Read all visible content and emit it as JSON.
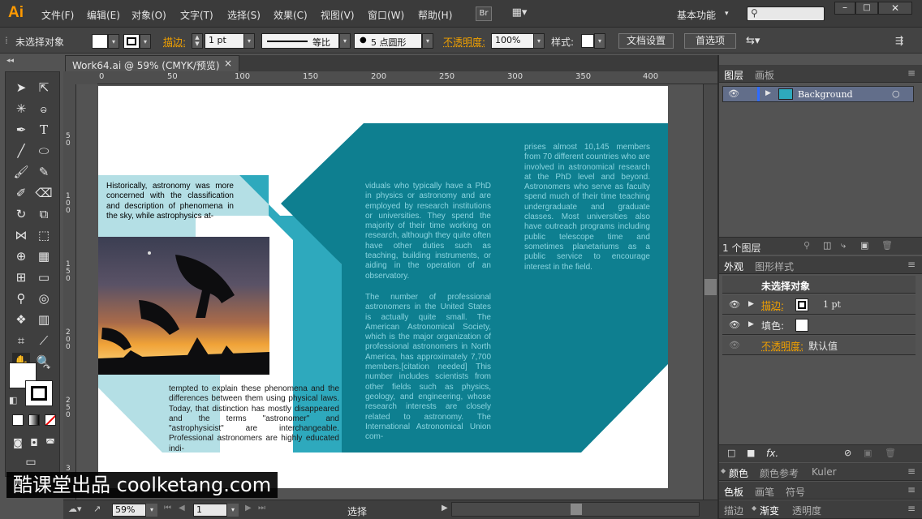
{
  "app": {
    "logo": "Ai"
  },
  "menu": [
    "文件(F)",
    "编辑(E)",
    "对象(O)",
    "文字(T)",
    "选择(S)",
    "效果(C)",
    "视图(V)",
    "窗口(W)",
    "帮助(H)"
  ],
  "menubar_right": {
    "br": "Br",
    "workspace": "基本功能"
  },
  "controlbar": {
    "selection": "未选择对象",
    "stroke_label": "描边:",
    "stroke_weight": "1 pt",
    "profile": "等比",
    "brush": "5 点圆形",
    "opacity_label": "不透明度:",
    "opacity_value": "100%",
    "style_label": "样式:",
    "doc_setup": "文档设置",
    "preferences": "首选项"
  },
  "document_tab": {
    "title": "Work64.ai @ 59% (CMYK/预览)",
    "close": "×"
  },
  "ruler_top_ticks": [
    "0",
    "50",
    "100",
    "150",
    "200",
    "250",
    "300",
    "350",
    "400"
  ],
  "ruler_left_ticks": [
    "5\n0",
    "1\n0\n0",
    "1\n5\n0",
    "2\n0\n0",
    "2\n5\n0",
    "3"
  ],
  "artwork": {
    "colors": {
      "teal": "#0e7f90",
      "teal_light": "#2ea9bd",
      "pale": "#b4dfe5",
      "text_on_teal": "#8ad5e0"
    },
    "intro_text": "Historically, astronomy was more concerned with the classification and description of phenomena in the sky, while astrophysics at-",
    "lower_text": "tempted to explain these phenomena and the differences between them using physical laws. Today, that distinction has mostly disappeared and the terms \"astronomer\" and \"astrophysicist\" are interchangeable. Professional astronomers are highly educated indi-",
    "middle_text_1": "viduals who typically have a PhD in physics or astronomy and are employed by research institutions or universities. They spend the majority of their time working on research, although they quite often have other duties such as teaching, building instruments, or aiding in the operation of an observatory.",
    "middle_text_2": "The number of professional astronomers in the United States is actually quite small. The American Astronomical Society, which is the major organization of professional astronomers in North America, has approximately 7,700 members.[citation needed] This number includes scientists from other fields such as physics, geology, and engineering, whose research interests are closely related to astronomy. The International Astronomical Union com-",
    "right_text": "prises almost 10,145 members from 70 different countries who are involved in astronomical research at the PhD level and beyond. Astronomers who serve as faculty spend much of their time teaching undergraduate and graduate classes. Most universities also have outreach programs including public telescope time and sometimes planetariums as a public service to encourage interest in the field."
  },
  "layers_panel": {
    "tabs": [
      "图层",
      "画板"
    ],
    "layer_name": "Background",
    "count": "1 个图层"
  },
  "appearance_panel": {
    "tabs": [
      "外观",
      "图形样式"
    ],
    "title": "未选择对象",
    "stroke_label": "描边:",
    "stroke_value": "1 pt",
    "fill_label": "填色:",
    "opacity_label": "不透明度:",
    "opacity_value": "默认值",
    "fx": "fx."
  },
  "collapsed_panels": [
    [
      "颜色",
      "颜色参考",
      "Kuler"
    ],
    [
      "色板",
      "画笔",
      "符号"
    ],
    [
      "描边",
      "渐变",
      "透明度"
    ]
  ],
  "status": {
    "zoom": "59%",
    "artboard": "1",
    "tool": "选择"
  },
  "watermark": "酷课堂出品 coolketang.com"
}
